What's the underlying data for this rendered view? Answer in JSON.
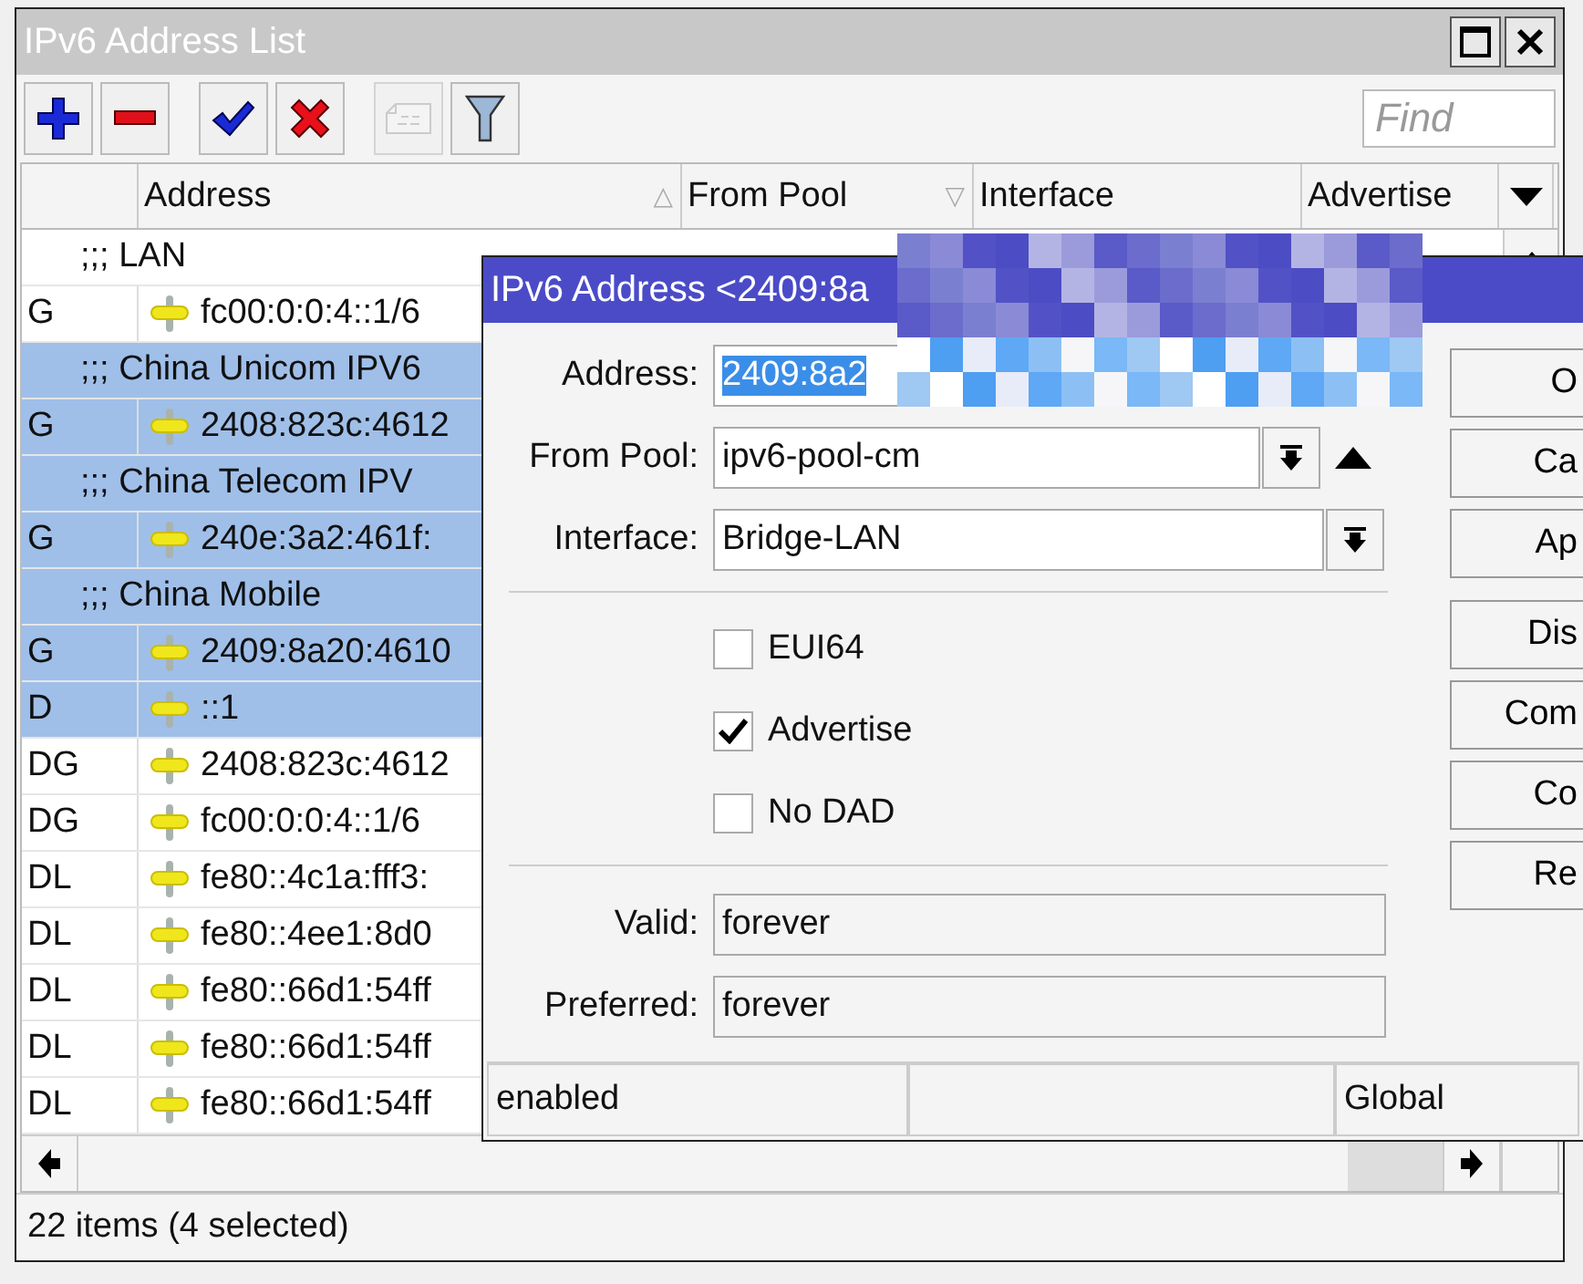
{
  "window": {
    "title": "IPv6 Address List"
  },
  "toolbar": {
    "buttons": [
      {
        "kind": "add",
        "disabled": false
      },
      {
        "kind": "remove",
        "disabled": false
      },
      {
        "kind": "enable",
        "disabled": false
      },
      {
        "kind": "disable",
        "disabled": false
      },
      {
        "kind": "comment",
        "disabled": true
      },
      {
        "kind": "filter",
        "disabled": false
      }
    ],
    "find": {
      "placeholder": "Find"
    }
  },
  "table": {
    "columns": [
      {
        "label": "Address",
        "sort_mark": "△"
      },
      {
        "label": "From Pool",
        "sort_mark": "▽"
      },
      {
        "label": "Interface"
      },
      {
        "label": "Advertise"
      }
    ],
    "rows": [
      {
        "kind": "comment",
        "text": ";;; LAN",
        "selected": false
      },
      {
        "kind": "address",
        "flags": "G",
        "address": "fc00:0:0:4::1/6",
        "selected": false
      },
      {
        "kind": "comment",
        "text": ";;; China Unicom IPV6",
        "selected": true
      },
      {
        "kind": "address",
        "flags": "G",
        "address": "2408:823c:4612",
        "selected": true
      },
      {
        "kind": "comment",
        "text": ";;; China Telecom IPV",
        "selected": true
      },
      {
        "kind": "address",
        "flags": "G",
        "address": "240e:3a2:461f:",
        "selected": true
      },
      {
        "kind": "comment",
        "text": ";;; China Mobile",
        "selected": true
      },
      {
        "kind": "address",
        "flags": "G",
        "address": "2409:8a20:4610",
        "selected": true
      },
      {
        "kind": "address",
        "flags": "D",
        "address": "::1",
        "selected": true
      },
      {
        "kind": "address",
        "flags": "DG",
        "address": "2408:823c:4612",
        "selected": false
      },
      {
        "kind": "address",
        "flags": "DG",
        "address": "fc00:0:0:4::1/6",
        "selected": false
      },
      {
        "kind": "address",
        "flags": "DL",
        "address": "fe80::4c1a:fff3:",
        "selected": false
      },
      {
        "kind": "address",
        "flags": "DL",
        "address": "fe80::4ee1:8d0",
        "selected": false
      },
      {
        "kind": "address",
        "flags": "DL",
        "address": "fe80::66d1:54ff",
        "selected": false
      },
      {
        "kind": "address",
        "flags": "DL",
        "address": "fe80::66d1:54ff",
        "selected": false
      },
      {
        "kind": "address",
        "flags": "DL",
        "address": "fe80::66d1:54ff",
        "selected": false
      }
    ]
  },
  "status_bar": "22 items (4 selected)",
  "dialog": {
    "title": "IPv6 Address <2409:8a",
    "fields": [
      {
        "kind": "selected-text",
        "label": "Address:",
        "value": "2409:8a2"
      },
      {
        "kind": "dropdown-removable",
        "label": "From Pool:",
        "value": "ipv6-pool-cm"
      },
      {
        "kind": "dropdown",
        "label": "Interface:",
        "value": "Bridge-LAN"
      }
    ],
    "checkboxes": [
      {
        "label": "EUI64",
        "checked": false
      },
      {
        "label": "Advertise",
        "checked": true
      },
      {
        "label": "No DAD",
        "checked": false
      }
    ],
    "lifetimes": [
      {
        "label": "Valid:",
        "value": "forever"
      },
      {
        "label": "Preferred:",
        "value": "forever"
      }
    ],
    "buttons": [
      "O",
      "Ca",
      "Ap",
      "Dis",
      "Com",
      "Co",
      "Re"
    ],
    "status_bar": {
      "state": "enabled",
      "scope": "Global"
    }
  }
}
